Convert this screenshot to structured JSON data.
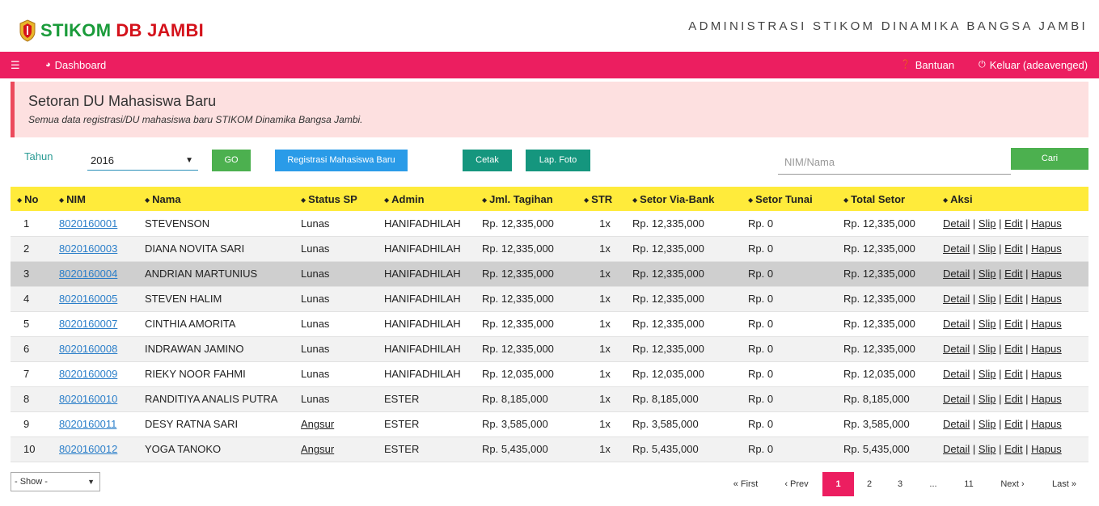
{
  "header": {
    "logo_part1": "STIKOM",
    "logo_part2": "DB JAMBI",
    "site_title": "ADMINISTRASI STIKOM DINAMIKA BANGSA JAMBI"
  },
  "nav": {
    "menu_icon": "hamburger-icon",
    "dashboard": "Dashboard",
    "bantuan": "Bantuan",
    "keluar": "Keluar (adeavenged)",
    "accent": "#ec1e60"
  },
  "panel": {
    "title": "Setoran DU Mahasiswa Baru",
    "subtitle": "Semua data registrasi/DU mahasiswa baru STIKOM Dinamika Bangsa Jambi."
  },
  "filter": {
    "tahun_label": "Tahun",
    "tahun_value": "2016",
    "go": "GO",
    "registrasi": "Registrasi Mahasiswa Baru",
    "cetak": "Cetak",
    "lap_foto": "Lap. Foto",
    "search_placeholder": "NIM/Nama",
    "cari": "Cari"
  },
  "table": {
    "headers": [
      "No",
      "NIM",
      "Nama",
      "Status SP",
      "Admin",
      "Jml. Tagihan",
      "STR",
      "Setor Via-Bank",
      "Setor Tunai",
      "Total Setor",
      "Aksi"
    ],
    "actions": [
      "Detail",
      "Slip",
      "Edit",
      "Hapus"
    ],
    "rows": [
      {
        "no": "1",
        "nim": "8020160001",
        "nama": "STEVENSON",
        "status": "Lunas",
        "admin": "HANIFADHILAH",
        "tagihan": "Rp. 12,335,000",
        "str": "1x",
        "bank": "Rp. 12,335,000",
        "tunai": "Rp. 0",
        "total": "Rp. 12,335,000"
      },
      {
        "no": "2",
        "nim": "8020160003",
        "nama": "DIANA NOVITA SARI",
        "status": "Lunas",
        "admin": "HANIFADHILAH",
        "tagihan": "Rp. 12,335,000",
        "str": "1x",
        "bank": "Rp. 12,335,000",
        "tunai": "Rp. 0",
        "total": "Rp. 12,335,000"
      },
      {
        "no": "3",
        "nim": "8020160004",
        "nama": "ANDRIAN MARTUNIUS",
        "status": "Lunas",
        "admin": "HANIFADHILAH",
        "tagihan": "Rp. 12,335,000",
        "str": "1x",
        "bank": "Rp. 12,335,000",
        "tunai": "Rp. 0",
        "total": "Rp. 12,335,000"
      },
      {
        "no": "4",
        "nim": "8020160005",
        "nama": "STEVEN HALIM",
        "status": "Lunas",
        "admin": "HANIFADHILAH",
        "tagihan": "Rp. 12,335,000",
        "str": "1x",
        "bank": "Rp. 12,335,000",
        "tunai": "Rp. 0",
        "total": "Rp. 12,335,000"
      },
      {
        "no": "5",
        "nim": "8020160007",
        "nama": "CINTHIA AMORITA",
        "status": "Lunas",
        "admin": "HANIFADHILAH",
        "tagihan": "Rp. 12,335,000",
        "str": "1x",
        "bank": "Rp. 12,335,000",
        "tunai": "Rp. 0",
        "total": "Rp. 12,335,000"
      },
      {
        "no": "6",
        "nim": "8020160008",
        "nama": "INDRAWAN JAMINO",
        "status": "Lunas",
        "admin": "HANIFADHILAH",
        "tagihan": "Rp. 12,335,000",
        "str": "1x",
        "bank": "Rp. 12,335,000",
        "tunai": "Rp. 0",
        "total": "Rp. 12,335,000"
      },
      {
        "no": "7",
        "nim": "8020160009",
        "nama": "RIEKY NOOR FAHMI",
        "status": "Lunas",
        "admin": "HANIFADHILAH",
        "tagihan": "Rp. 12,035,000",
        "str": "1x",
        "bank": "Rp. 12,035,000",
        "tunai": "Rp. 0",
        "total": "Rp. 12,035,000"
      },
      {
        "no": "8",
        "nim": "8020160010",
        "nama": "RANDITIYA ANALIS PUTRA",
        "status": "Lunas",
        "admin": "ESTER",
        "tagihan": "Rp. 8,185,000",
        "str": "1x",
        "bank": "Rp. 8,185,000",
        "tunai": "Rp. 0",
        "total": "Rp. 8,185,000"
      },
      {
        "no": "9",
        "nim": "8020160011",
        "nama": "DESY RATNA SARI",
        "status": "Angsur",
        "admin": "ESTER",
        "tagihan": "Rp. 3,585,000",
        "str": "1x",
        "bank": "Rp. 3,585,000",
        "tunai": "Rp. 0",
        "total": "Rp. 3,585,000"
      },
      {
        "no": "10",
        "nim": "8020160012",
        "nama": "YOGA TANOKO",
        "status": "Angsur",
        "admin": "ESTER",
        "tagihan": "Rp. 5,435,000",
        "str": "1x",
        "bank": "Rp. 5,435,000",
        "tunai": "Rp. 0",
        "total": "Rp. 5,435,000"
      }
    ]
  },
  "footer": {
    "show": "- Show -",
    "pages": [
      "« First",
      "‹ Prev",
      "1",
      "2",
      "3",
      "...",
      "11",
      "Next ›",
      "Last »"
    ],
    "active_page": "1"
  }
}
